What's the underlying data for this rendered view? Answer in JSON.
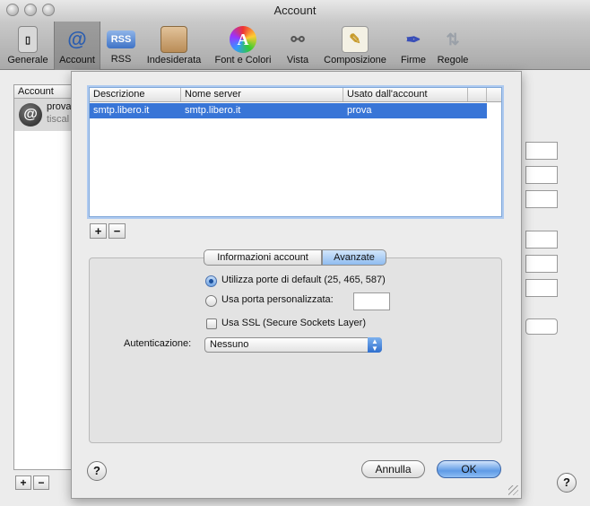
{
  "window": {
    "title": "Account"
  },
  "toolbar": {
    "items": [
      {
        "label": "Generale"
      },
      {
        "label": "Account"
      },
      {
        "label": "RSS"
      },
      {
        "label": "Indesiderata"
      },
      {
        "label": "Font e Colori"
      },
      {
        "label": "Vista"
      },
      {
        "label": "Composizione"
      },
      {
        "label": "Firme"
      },
      {
        "label": "Regole"
      }
    ],
    "selected": "Account",
    "rss_badge": "RSS"
  },
  "accounts": {
    "header": "Account",
    "items": [
      {
        "name": "prova",
        "server": "tiscal"
      }
    ],
    "add_label": "+",
    "remove_label": "−"
  },
  "sheet": {
    "table": {
      "columns": [
        "Descrizione",
        "Nome server",
        "Usato dall'account"
      ],
      "rows": [
        {
          "description": "smtp.libero.it",
          "server": "smtp.libero.it",
          "account": "prova"
        }
      ]
    },
    "add_label": "+",
    "remove_label": "−",
    "tabs": [
      {
        "label": "Informazioni account"
      },
      {
        "label": "Avanzate"
      }
    ],
    "selected_tab": "Avanzate",
    "port_default_label": "Utilizza porte di default (25, 465, 587)",
    "port_custom_label": "Usa porta personalizzata:",
    "port_custom_value": "",
    "ssl_label": "Usa SSL (Secure Sockets Layer)",
    "auth_label": "Autenticazione:",
    "auth_value": "Nessuno",
    "help_label": "?",
    "cancel_label": "Annulla",
    "ok_label": "OK"
  },
  "help_label": "?",
  "colors": {
    "selection": "#3875d7",
    "ok_button": "#5f9be6"
  }
}
